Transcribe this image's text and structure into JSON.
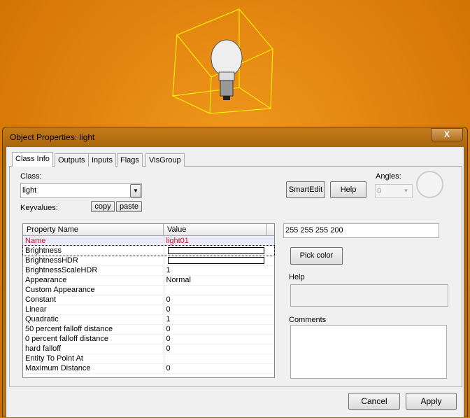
{
  "window": {
    "title": "Object Properties: light",
    "close": "X"
  },
  "tabs": [
    "Class Info",
    "Outputs",
    "Inputs",
    "Flags",
    "VisGroup"
  ],
  "class_info": {
    "class_label": "Class:",
    "class_value": "light",
    "keyvalues_label": "Keyvalues:",
    "copy": "copy",
    "paste": "paste",
    "smartedit": "SmartEdit",
    "help_button": "Help",
    "angles_label": "Angles:",
    "angles_value": "0"
  },
  "table": {
    "headers": [
      "Property Name",
      "Value"
    ],
    "rows": [
      {
        "name": "Name",
        "value": "light01"
      },
      {
        "name": "Brightness",
        "value": ""
      },
      {
        "name": "BrightnessHDR",
        "value": ""
      },
      {
        "name": "BrightnessScaleHDR",
        "value": "1"
      },
      {
        "name": "Appearance",
        "value": "Normal"
      },
      {
        "name": "Custom Appearance",
        "value": ""
      },
      {
        "name": "Constant",
        "value": "0"
      },
      {
        "name": "Linear",
        "value": "0"
      },
      {
        "name": "Quadratic",
        "value": "1"
      },
      {
        "name": "50 percent falloff distance",
        "value": "0"
      },
      {
        "name": "0 percent falloff distance",
        "value": "0"
      },
      {
        "name": "hard falloff",
        "value": "0"
      },
      {
        "name": "Entity To Point At",
        "value": ""
      },
      {
        "name": "Maximum Distance",
        "value": "0"
      }
    ]
  },
  "editor": {
    "value": "255 255 255 200",
    "pick_color": "Pick color",
    "help_label": "Help",
    "comments_label": "Comments"
  },
  "footer": {
    "cancel": "Cancel",
    "apply": "Apply"
  },
  "colors": {
    "selected_text": "#e0102a",
    "viewport": "#e07f0a",
    "wireframe": "#ffff00"
  }
}
